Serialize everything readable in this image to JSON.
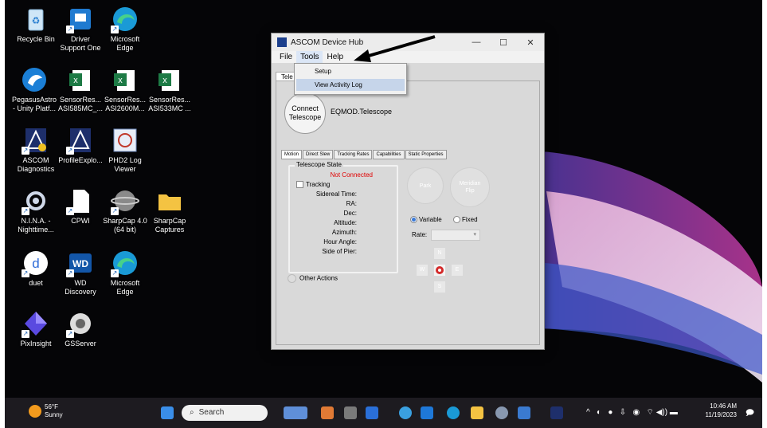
{
  "desktop": {
    "icons": [
      {
        "label": "Recycle Bin",
        "icon": "recycle-bin-icon"
      },
      {
        "label": "Driver\nSupport One",
        "icon": "driver-support-icon"
      },
      {
        "label": "Microsoft\nEdge",
        "icon": "edge-icon"
      },
      {
        "label": "PegasusAstro\n- Unity Platf...",
        "icon": "pegasus-icon"
      },
      {
        "label": "SensorRes...\nASI585MC_...",
        "icon": "excel-icon"
      },
      {
        "label": "SensorRes...\nASI2600M...",
        "icon": "excel-icon"
      },
      {
        "label": "SensorRes...\nASI533MC ...",
        "icon": "excel-icon"
      },
      {
        "label": "ASCOM\nDiagnostics",
        "icon": "ascom-icon"
      },
      {
        "label": "ProfileExplo...",
        "icon": "ascom-profile-icon"
      },
      {
        "label": "PHD2 Log\nViewer",
        "icon": "phd2-icon"
      },
      {
        "label": "N.I.N.A. -\nNighttime...",
        "icon": "nina-icon"
      },
      {
        "label": "CPWI",
        "icon": "file-icon"
      },
      {
        "label": "SharpCap 4.0\n(64 bit)",
        "icon": "sharpcap-icon"
      },
      {
        "label": "SharpCap\nCaptures",
        "icon": "folder-icon"
      },
      {
        "label": "duet",
        "icon": "duet-icon"
      },
      {
        "label": "WD\nDiscovery",
        "icon": "wd-icon"
      },
      {
        "label": "Microsoft\nEdge",
        "icon": "edge-icon"
      },
      {
        "label": "PixInsight",
        "icon": "pixinsight-icon"
      },
      {
        "label": "GSServer",
        "icon": "gsserver-icon"
      }
    ]
  },
  "window": {
    "title": "ASCOM Device Hub",
    "menu": [
      "File",
      "Tools",
      "Help"
    ],
    "tab": "Tele",
    "dropdown": {
      "items": [
        "Setup",
        "View Activity Log"
      ]
    },
    "connect_label": "Connect\nTelescope",
    "driver": "EQMOD.Telescope",
    "subtabs": [
      "Motion",
      "Direct Slew",
      "Tracking Rates",
      "Capabilities",
      "Static Properties"
    ],
    "state": {
      "legend": "Telescope State",
      "status": "Not Connected",
      "tracking": "Tracking",
      "fields": [
        "Sidereal Time:",
        "RA:",
        "Dec:",
        "Altitude:",
        "Azimuth:",
        "Hour Angle:",
        "Side of Pier:"
      ]
    },
    "park": "Park",
    "meridian": "Meridian\nFlip",
    "variable": "Variable",
    "fixed": "Fixed",
    "rate": "Rate:",
    "pad": {
      "n": "N",
      "w": "W",
      "e": "E",
      "s": "S"
    },
    "other_actions": "Other Actions"
  },
  "taskbar": {
    "weather_temp": "56°F",
    "weather_desc": "Sunny",
    "search": "Search",
    "time": "10:46 AM",
    "date": "11/19/2023"
  },
  "colors": {
    "status_red": "#e00000",
    "accent": "#3a79d6"
  }
}
